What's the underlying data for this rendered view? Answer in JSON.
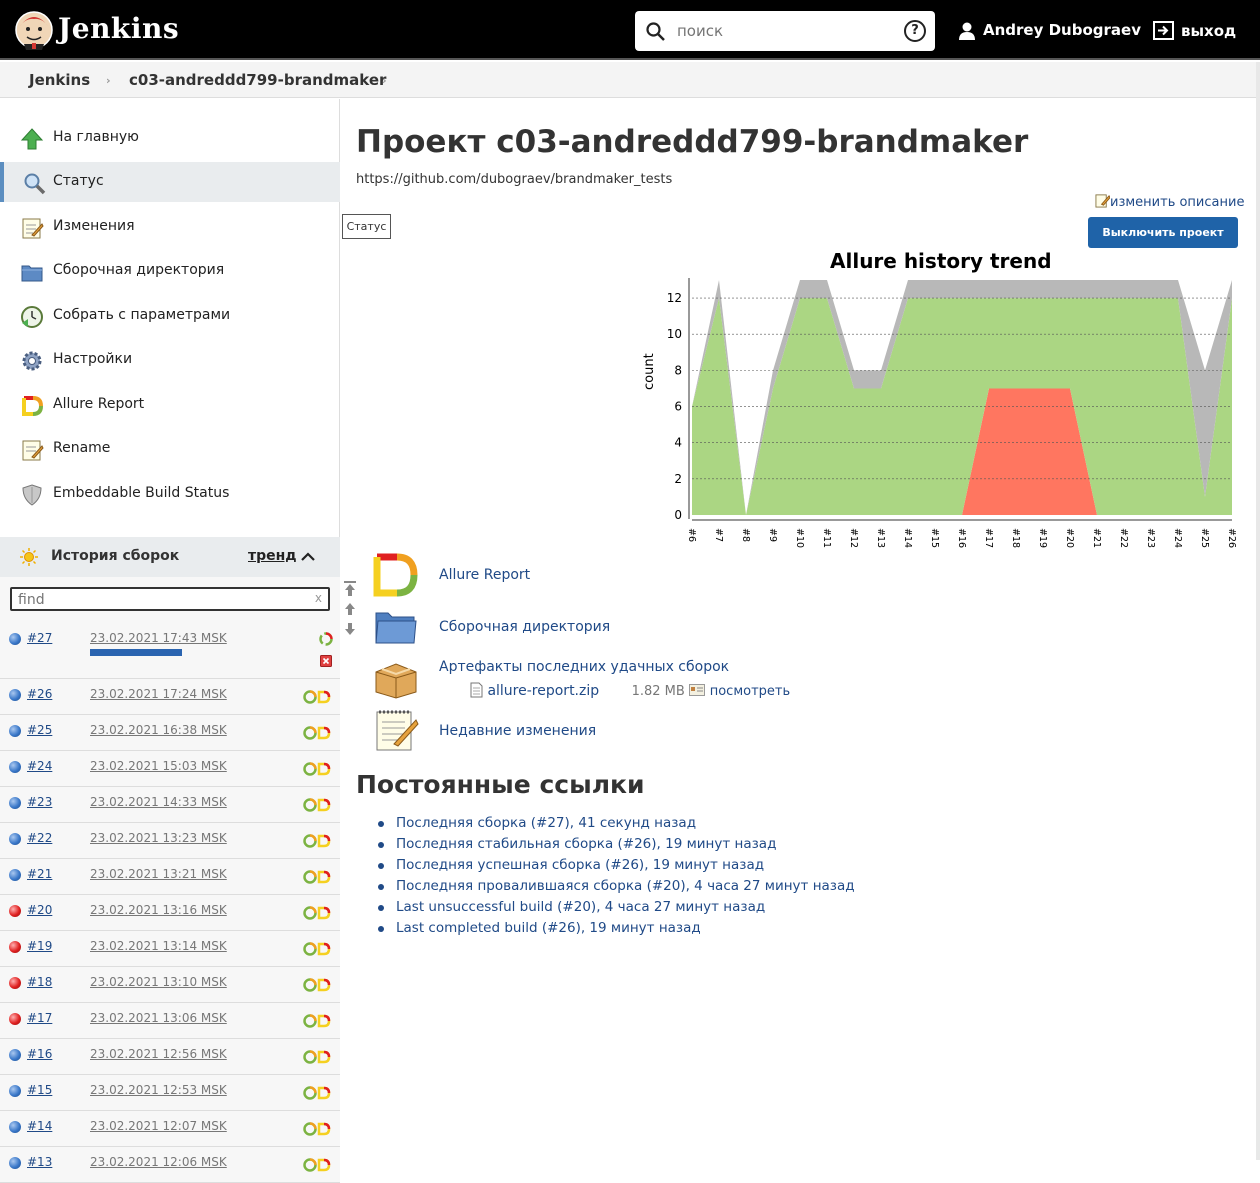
{
  "header": {
    "brand": "Jenkins",
    "search_placeholder": "поиск",
    "help_label": "?",
    "user_name": "Andrey Dubograev",
    "logout_label": "выход"
  },
  "breadcrumb": [
    "Jenkins",
    "c03-andreddd799-brandmaker"
  ],
  "sidebar": {
    "tasks": [
      {
        "label": "На главную",
        "icon": "up-arrow-icon"
      },
      {
        "label": "Статус",
        "icon": "magnifier-icon"
      },
      {
        "label": "Изменения",
        "icon": "notepad-icon"
      },
      {
        "label": "Сборочная директория",
        "icon": "folder-icon"
      },
      {
        "label": "Собрать с параметрами",
        "icon": "clock-icon"
      },
      {
        "label": "Настройки",
        "icon": "gear-icon"
      },
      {
        "label": "Allure Report",
        "icon": "allure-icon"
      },
      {
        "label": "Rename",
        "icon": "notepad-icon"
      },
      {
        "label": "Embeddable Build Status",
        "icon": "shield-icon"
      }
    ],
    "tooltip": "Статус"
  },
  "build_history": {
    "title": "История сборок",
    "trend_link": "тренд",
    "filter_placeholder": "find",
    "filter_clear": "x",
    "builds": [
      {
        "num": "#27",
        "date": "23.02.2021 17:43 MSK",
        "status": "blue",
        "progress": 1.0
      },
      {
        "num": "#26",
        "date": "23.02.2021 17:24 MSK",
        "status": "blue"
      },
      {
        "num": "#25",
        "date": "23.02.2021 16:38 MSK",
        "status": "blue"
      },
      {
        "num": "#24",
        "date": "23.02.2021 15:03 MSK",
        "status": "blue"
      },
      {
        "num": "#23",
        "date": "23.02.2021 14:33 MSK",
        "status": "blue"
      },
      {
        "num": "#22",
        "date": "23.02.2021 13:23 MSK",
        "status": "blue"
      },
      {
        "num": "#21",
        "date": "23.02.2021 13:21 MSK",
        "status": "blue"
      },
      {
        "num": "#20",
        "date": "23.02.2021 13:16 MSK",
        "status": "red"
      },
      {
        "num": "#19",
        "date": "23.02.2021 13:14 MSK",
        "status": "red"
      },
      {
        "num": "#18",
        "date": "23.02.2021 13:10 MSK",
        "status": "red"
      },
      {
        "num": "#17",
        "date": "23.02.2021 13:06 MSK",
        "status": "red"
      },
      {
        "num": "#16",
        "date": "23.02.2021 12:56 MSK",
        "status": "blue"
      },
      {
        "num": "#15",
        "date": "23.02.2021 12:53 MSK",
        "status": "blue"
      },
      {
        "num": "#14",
        "date": "23.02.2021 12:07 MSK",
        "status": "blue"
      },
      {
        "num": "#13",
        "date": "23.02.2021 12:06 MSK",
        "status": "blue"
      }
    ]
  },
  "main": {
    "title": "Проект c03-andreddd799-brandmaker",
    "description": "https://github.com/dubograev/brandmaker_tests",
    "edit_description": "изменить описание",
    "disable_button": "Выключить проект",
    "actions": [
      {
        "label": "Allure Report",
        "icon": "allure-icon"
      },
      {
        "label": "Сборочная директория",
        "icon": "folder-icon"
      },
      {
        "label": "Артефакты последних удачных сборок",
        "icon": "package-icon"
      },
      {
        "label": "Недавние изменения",
        "icon": "notepad-icon"
      }
    ],
    "artifact": {
      "name": "allure-report.zip",
      "size": "1.82 MB",
      "view": "посмотреть"
    },
    "permalinks_title": "Постоянные ссылки",
    "permalinks": [
      "Последняя сборка (#27), 41 секунд назад",
      "Последняя стабильная сборка (#26), 19 минут назад",
      "Последняя успешная сборка (#26), 19 минут назад",
      "Последняя провалившаяся сборка (#20), 4 часа 27 минут назад",
      "Last unsuccessful build (#20), 4 часа 27 минут назад",
      "Last completed build (#26), 19 минут назад"
    ]
  },
  "chart_data": {
    "type": "area",
    "title": "Allure history trend",
    "xlabel": "",
    "ylabel": "count",
    "ylim": [
      0,
      13
    ],
    "yticks": [
      0,
      2,
      4,
      6,
      8,
      10,
      12
    ],
    "grid": true,
    "categories": [
      "#6",
      "#7",
      "#8",
      "#9",
      "#10",
      "#11",
      "#12",
      "#13",
      "#14",
      "#15",
      "#16",
      "#17",
      "#18",
      "#19",
      "#20",
      "#21",
      "#22",
      "#23",
      "#24",
      "#25",
      "#26"
    ],
    "series": [
      {
        "color": "#ff7660",
        "values": [
          0,
          0,
          0,
          0,
          0,
          0,
          0,
          0,
          0,
          0,
          0,
          7,
          7,
          7,
          7,
          0,
          0,
          0,
          0,
          0,
          0
        ]
      },
      {
        "color": "#abd683",
        "values": [
          6,
          12,
          0,
          7,
          12,
          12,
          7,
          7,
          12,
          12,
          12,
          5,
          5,
          5,
          5,
          12,
          12,
          12,
          12,
          1,
          12
        ]
      },
      {
        "color": "#b8b8b8",
        "values": [
          0,
          1,
          0,
          1,
          1,
          1,
          1,
          1,
          1,
          1,
          1,
          1,
          1,
          1,
          1,
          1,
          1,
          1,
          1,
          7,
          1
        ]
      }
    ]
  }
}
